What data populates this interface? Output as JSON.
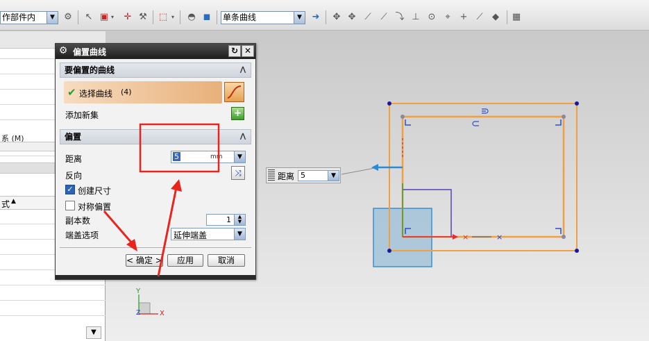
{
  "toolbar": {
    "scope_select": "作部件内",
    "curve_rule_select": "单条曲线"
  },
  "dialog": {
    "title": "偏置曲线",
    "section_curves": "要偏置的曲线",
    "select_curve_label": "选择曲线",
    "select_curve_count": "(4)",
    "add_new_set_label": "添加新集",
    "section_offset": "偏置",
    "distance_label": "距离",
    "distance_value": "5",
    "distance_unit": "mm",
    "reverse_label": "反向",
    "create_dim_label": "创建尺寸",
    "create_dim_checked": true,
    "symmetric_label": "对称偏置",
    "symmetric_checked": false,
    "copies_label": "副本数",
    "copies_value": "1",
    "end_cap_label": "端盖选项",
    "end_cap_value": "延伸端盖",
    "ok_label": "< 确定 >",
    "apply_label": "应用",
    "cancel_label": "取消"
  },
  "left_panel": {
    "row_text": "系 (M)",
    "column_header": "式"
  },
  "float_entry": {
    "label": "距离",
    "value": "5"
  },
  "axes": {
    "x": "X",
    "y": "Y",
    "z": "Z"
  },
  "colors": {
    "offset_curve": "#f0a040",
    "selection_highlight": "#ff2020",
    "dialog_title": "#2a2a2a",
    "accent_blue": "#2c63b8"
  }
}
